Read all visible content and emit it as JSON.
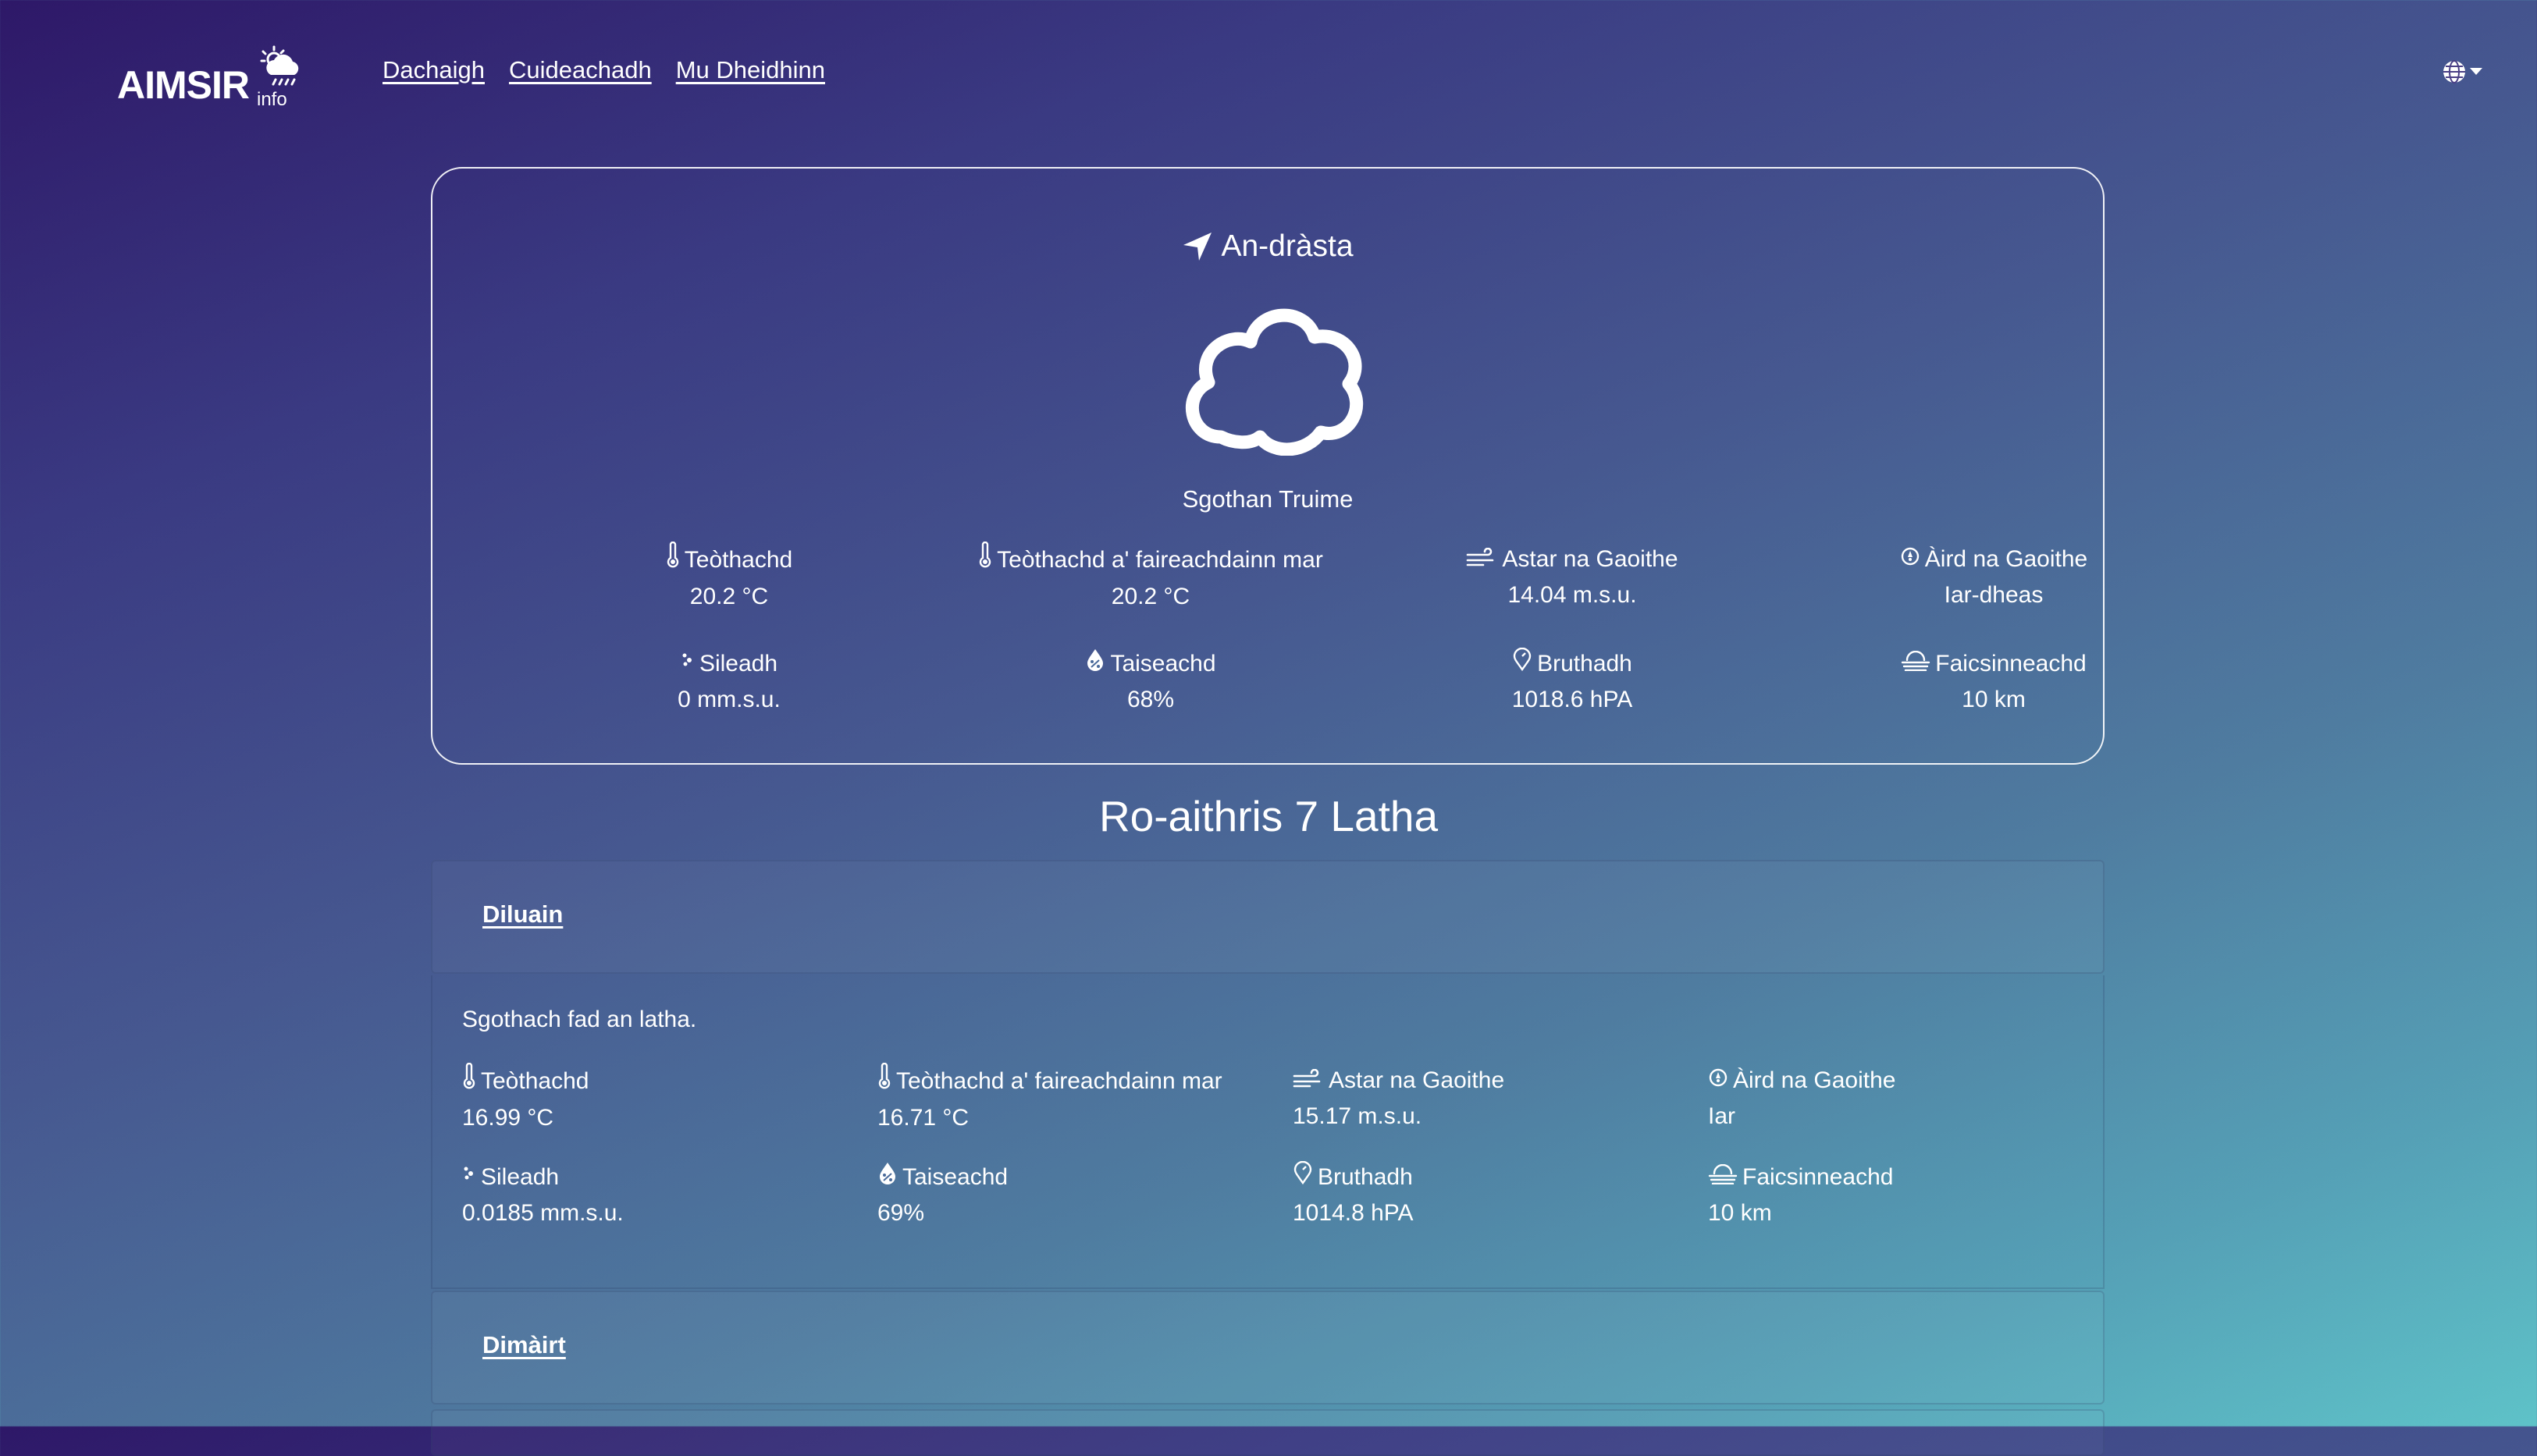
{
  "nav": {
    "logo_main": "AIMSIR",
    "logo_sub": "info",
    "links": [
      "Dachaigh",
      "Cuideachadh",
      "Mu Dheidhinn"
    ]
  },
  "current": {
    "title": "An-dràsta",
    "icon": "cloud-icon",
    "condition": "Sgothan Truime",
    "stats": [
      {
        "icon": "thermometer-icon",
        "label": "Teòthachd",
        "value": "20.2 °C"
      },
      {
        "icon": "thermometer-icon",
        "label": "Teòthachd a' faireachdainn mar",
        "value": "20.2 °C"
      },
      {
        "icon": "wind-icon",
        "label": "Astar na Gaoithe",
        "value": "14.04 m.s.u."
      },
      {
        "icon": "compass-icon",
        "label": "Àird na Gaoithe",
        "value": "Iar-dheas"
      },
      {
        "icon": "rain-drops-icon",
        "label": "Sileadh",
        "value": "0 mm.s.u."
      },
      {
        "icon": "humidity-icon",
        "label": "Taiseachd",
        "value": "68%"
      },
      {
        "icon": "pressure-icon",
        "label": "Bruthadh",
        "value": "1018.6 hPA"
      },
      {
        "icon": "visibility-icon",
        "label": "Faicsinneachd",
        "value": "10 km"
      }
    ]
  },
  "forecast": {
    "title": "Ro-aithris 7 Latha",
    "days": [
      {
        "name": "Diluain",
        "summary": "Sgothach fad an latha.",
        "stats": [
          {
            "icon": "thermometer-icon",
            "label": "Teòthachd",
            "value": "16.99 °C"
          },
          {
            "icon": "thermometer-icon",
            "label": "Teòthachd a' faireachdainn mar",
            "value": "16.71 °C"
          },
          {
            "icon": "wind-icon",
            "label": "Astar na Gaoithe",
            "value": "15.17 m.s.u."
          },
          {
            "icon": "compass-icon",
            "label": "Àird na Gaoithe",
            "value": "Iar"
          },
          {
            "icon": "rain-drops-icon",
            "label": "Sileadh",
            "value": "0.0185 mm.s.u."
          },
          {
            "icon": "humidity-icon",
            "label": "Taiseachd",
            "value": "69%"
          },
          {
            "icon": "pressure-icon",
            "label": "Bruthadh",
            "value": "1014.8 hPA"
          },
          {
            "icon": "visibility-icon",
            "label": "Faicsinneachd",
            "value": "10 km"
          }
        ]
      },
      {
        "name": "Dimàirt"
      }
    ]
  }
}
